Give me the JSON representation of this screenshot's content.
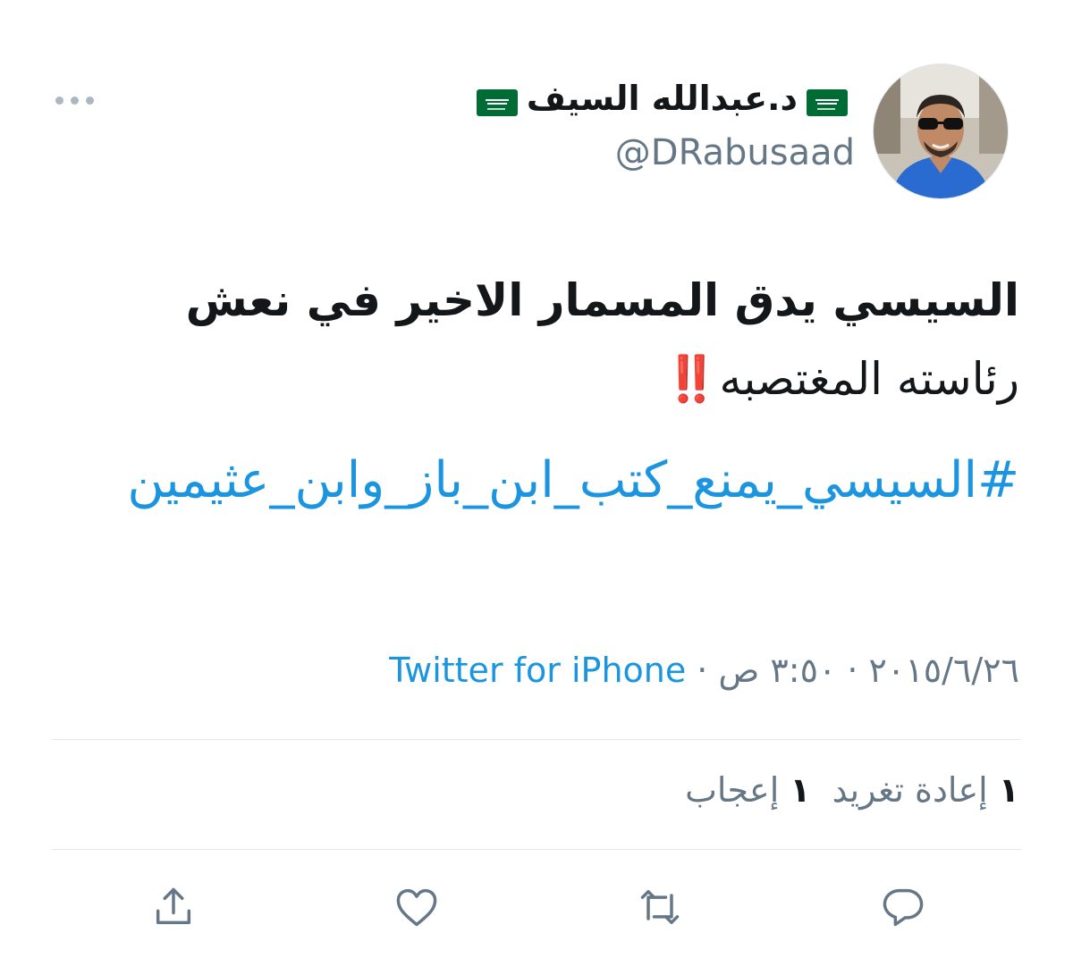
{
  "header": {
    "display_name": "د.عبدالله السيف",
    "handle": "@DRabusaad",
    "more_label": "More options"
  },
  "tweet": {
    "text_line1": "السيسي يدق المسمار الاخير في نعش",
    "text_line2": "رئاسته المغتصبه",
    "exclaim": "‼️",
    "hashtag": "#السيسي_يمنع_كتب_ابن_باز_وابن_عثيمين"
  },
  "meta": {
    "date": "٢٠١٥/٦/٢٦",
    "sep1": "·",
    "time": "٣:٥٠ ص",
    "sep2": "·",
    "source": "Twitter for iPhone"
  },
  "stats": {
    "retweets_count": "١",
    "retweets_label": "إعادة تغريد",
    "likes_count": "١",
    "likes_label": "إعجاب"
  },
  "colors": {
    "link": "#1b95e0",
    "muted": "#657786",
    "text": "#14171a",
    "divider": "#e1e8ed",
    "flag_green": "#006c35"
  },
  "icons": [
    "more-dots-icon",
    "share-icon",
    "like-icon",
    "retweet-icon",
    "reply-icon"
  ]
}
